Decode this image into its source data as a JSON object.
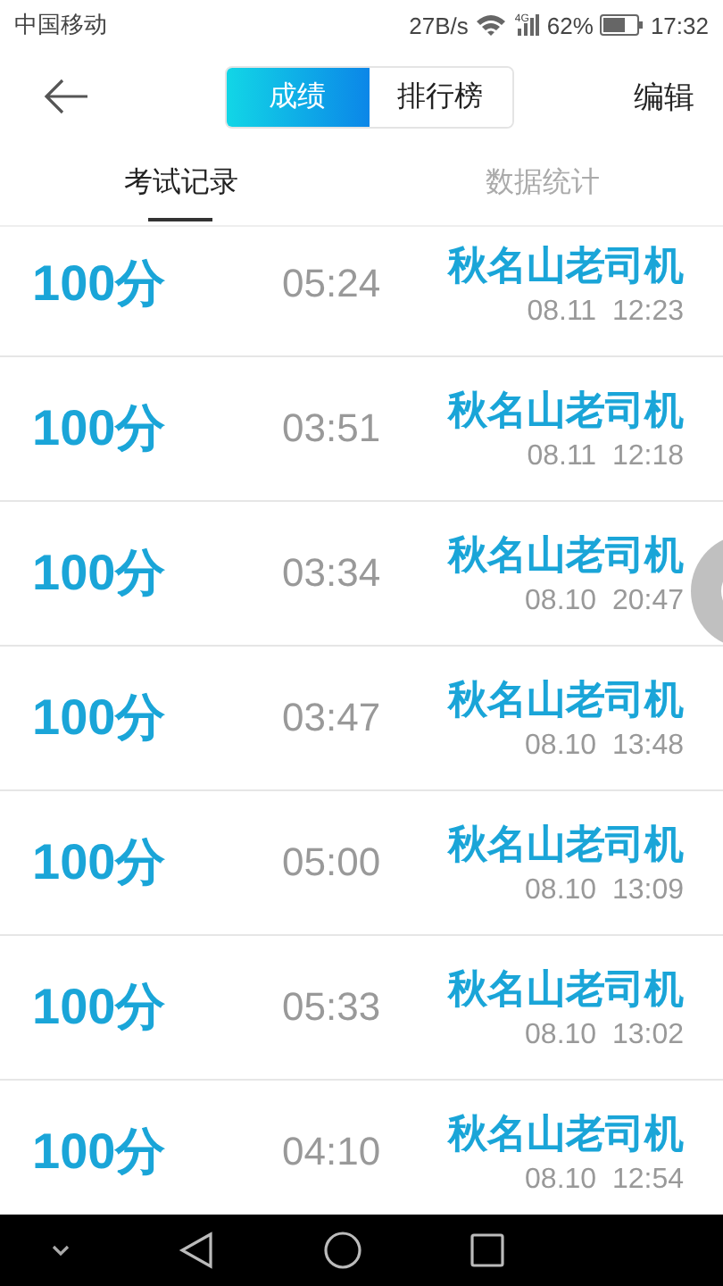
{
  "status_bar": {
    "carrier": "中国移动",
    "speed": "27B/s",
    "network": "4G",
    "battery": "62%",
    "time": "17:32"
  },
  "header": {
    "segments": [
      {
        "label": "成绩",
        "selected": true
      },
      {
        "label": "排行榜",
        "selected": false
      }
    ],
    "action": "编辑"
  },
  "tabs": [
    {
      "label": "考试记录",
      "selected": true
    },
    {
      "label": "数据统计",
      "selected": false
    }
  ],
  "records": [
    {
      "score": "100分",
      "duration": "05:24",
      "name": "秋名山老司机",
      "date": "08.11",
      "time": "12:23"
    },
    {
      "score": "100分",
      "duration": "03:51",
      "name": "秋名山老司机",
      "date": "08.11",
      "time": "12:18"
    },
    {
      "score": "100分",
      "duration": "03:34",
      "name": "秋名山老司机",
      "date": "08.10",
      "time": "20:47"
    },
    {
      "score": "100分",
      "duration": "03:47",
      "name": "秋名山老司机",
      "date": "08.10",
      "time": "13:48"
    },
    {
      "score": "100分",
      "duration": "05:00",
      "name": "秋名山老司机",
      "date": "08.10",
      "time": "13:09"
    },
    {
      "score": "100分",
      "duration": "05:33",
      "name": "秋名山老司机",
      "date": "08.10",
      "time": "13:02"
    },
    {
      "score": "100分",
      "duration": "04:10",
      "name": "秋名山老司机",
      "date": "08.10",
      "time": "12:54"
    }
  ]
}
